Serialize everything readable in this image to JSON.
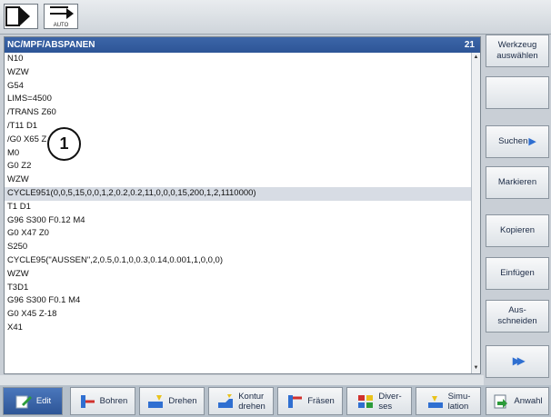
{
  "top": {
    "auto_label": "AUTO"
  },
  "editor": {
    "path": "NC/MPF/ABSPANEN",
    "count": "21",
    "lines": [
      "N10",
      "WZW",
      "G54",
      "LIMS=4500",
      "/TRANS Z60",
      "/T11 D1",
      "/G0 X65 Z",
      "M0",
      "G0 Z2",
      "WZW",
      "CYCLE951(0,0,5,15,0,0,1,2,0.2,0.2,11,0,0,0,15,200,1,2,1110000)",
      "T1 D1",
      "G96 S300 F0.12 M4",
      "G0 X47 Z0",
      "S250",
      "CYCLE95(\"AUSSEN\",2,0.5,0.1,0,0.3,0.14,0.001,1,0,0,0)",
      "WZW",
      "T3D1",
      "G96 S300 F0.1 M4",
      "G0 X45 Z-18",
      "X41"
    ],
    "selected_index": 10,
    "marker": "1"
  },
  "vertical_softkeys": {
    "werkzeug_line1": "Werkzeug",
    "werkzeug_line2": "auswählen",
    "suchen": "Suchen",
    "markieren": "Markieren",
    "kopieren": "Kopieren",
    "einfuegen": "Einfügen",
    "ausschneiden_line1": "Aus-",
    "ausschneiden_line2": "schneiden",
    "more_symbol": "▸▸"
  },
  "horizontal_softkeys": {
    "edit": "Edit",
    "bohren": "Bohren",
    "drehen": "Drehen",
    "kontur_line1": "Kontur",
    "kontur_line2": "drehen",
    "fraesen": "Fräsen",
    "diverses_line1": "Diver-",
    "diverses_line2": "ses",
    "simulation_line1": "Simu-",
    "simulation_line2": "lation",
    "anwahl": "Anwahl"
  },
  "colors": {
    "title_bar": "#2d5597",
    "selection": "#d7dce4",
    "accent_arrow": "#2f6fd1",
    "icon_red": "#d0312d",
    "icon_yellow": "#e9c21a",
    "icon_green": "#2c9b3a"
  }
}
